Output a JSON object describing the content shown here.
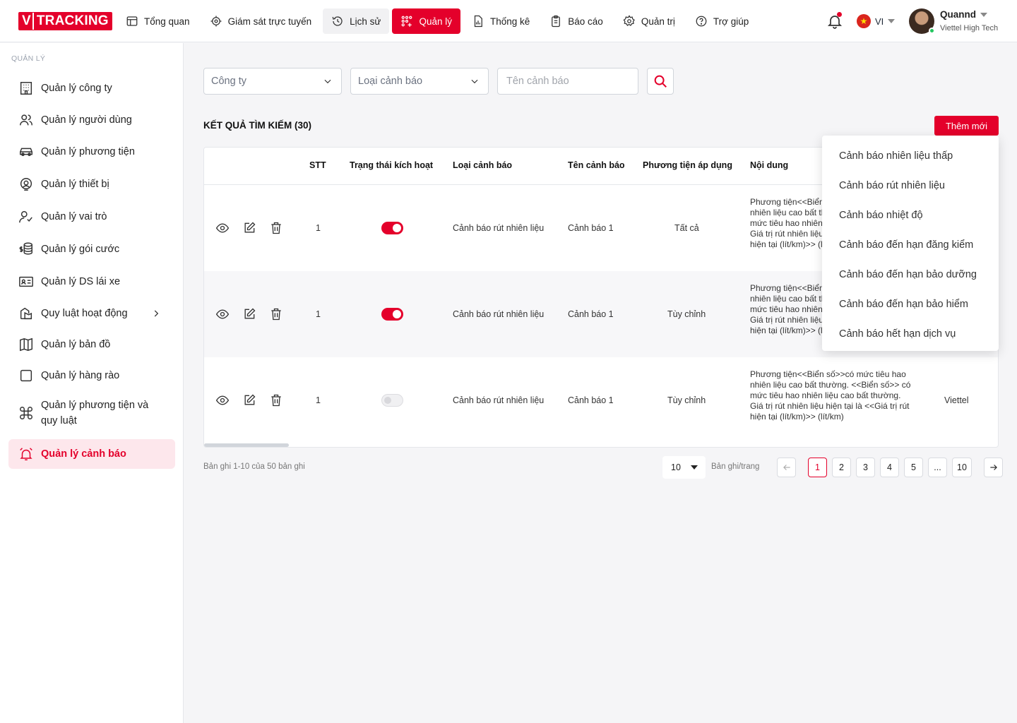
{
  "brand": {
    "logo_v": "V",
    "logo_text": "TRACKING",
    "accent": "#e4002b"
  },
  "nav": {
    "items": [
      {
        "label": "Tổng quan",
        "icon": "dashboard-icon"
      },
      {
        "label": "Giám sát trực tuyến",
        "icon": "crosshair-icon"
      },
      {
        "label": "Lịch sử",
        "icon": "history-icon"
      },
      {
        "label": "Quản lý",
        "icon": "management-icon"
      },
      {
        "label": "Thống kê",
        "icon": "chart-file-icon"
      },
      {
        "label": "Báo cáo",
        "icon": "clipboard-icon"
      },
      {
        "label": "Quản trị",
        "icon": "gear-icon"
      },
      {
        "label": "Trợ giúp",
        "icon": "help-icon"
      }
    ]
  },
  "header": {
    "language": "VI",
    "user_name": "Quannd",
    "user_org": "Viettel High Tech"
  },
  "sidebar": {
    "title": "QUẢN LÝ",
    "items": [
      {
        "label": "Quản lý công ty",
        "icon": "building-icon"
      },
      {
        "label": "Quản lý người dùng",
        "icon": "users-icon"
      },
      {
        "label": "Quản lý phương tiện",
        "icon": "car-icon"
      },
      {
        "label": "Quản lý thiết bị",
        "icon": "device-icon"
      },
      {
        "label": "Quản lý vai trò",
        "icon": "user-check-icon"
      },
      {
        "label": "Quản lý gói cước",
        "icon": "coins-icon"
      },
      {
        "label": "Quản lý DS lái xe",
        "icon": "id-card-icon"
      },
      {
        "label": "Quy luật hoạt động",
        "icon": "rules-icon"
      },
      {
        "label": "Quản lý bản đồ",
        "icon": "map-icon"
      },
      {
        "label": "Quản lý hàng rào",
        "icon": "square-icon"
      },
      {
        "label": "Quản lý phương tiện và quy luật",
        "icon": "command-icon"
      },
      {
        "label": "Quản lý cảnh báo",
        "icon": "alarm-icon"
      }
    ]
  },
  "filters": {
    "company_placeholder": "Công ty",
    "alert_type_placeholder": "Loại cảnh báo",
    "alert_name_placeholder": "Tên cảnh báo"
  },
  "results": {
    "title": "KẾT QUẢ TÌM KIẾM (30)",
    "add_label": "Thêm mới"
  },
  "table": {
    "columns": [
      "STT",
      "Trạng thái kích hoạt",
      "Loại cảnh báo",
      "Tên cảnh báo",
      "Phương tiện áp dụng",
      "Nội dung"
    ],
    "rows": [
      {
        "stt": "1",
        "active": true,
        "type": "Cảnh báo rút nhiên liệu",
        "name": "Cảnh báo 1",
        "vehicles": "Tất cả",
        "content": "Phương tiện<<Biển số>>có mức tiêu hao nhiên liệu cao bất thường. <<Biển số>> có mức tiêu hao nhiên liệu cao bất thường. Giá trị rút nhiên liệu hiện tại là <<Giá trị rút hiện tại (lít/km)>> (lít/km)",
        "company": ""
      },
      {
        "stt": "1",
        "active": true,
        "type": "Cảnh báo rút nhiên liệu",
        "name": "Cảnh báo 1",
        "vehicles": "Tùy chỉnh",
        "content": "Phương tiện<<Biển số>>có mức tiêu hao nhiên liệu cao bất thường. <<Biển số>> có mức tiêu hao nhiên liệu cao bất thường. Giá trị rút nhiên liệu hiện tại là <<Giá trị rút hiện tại (lít/km)>> (lít/km)",
        "company": ""
      },
      {
        "stt": "1",
        "active": false,
        "type": "Cảnh báo rút nhiên liệu",
        "name": "Cảnh báo 1",
        "vehicles": "Tùy chỉnh",
        "content": "Phương tiện<<Biển số>>có mức tiêu hao nhiên liệu cao bất thường. <<Biển số>> có mức tiêu hao nhiên liệu cao bất thường. Giá trị rút nhiên liệu hiện tại là <<Giá trị rút hiện tại (lít/km)>> (lít/km)",
        "company": "Viettel"
      }
    ]
  },
  "dropdown": {
    "options": [
      "Cảnh báo nhiên liệu thấp",
      "Cảnh báo rút nhiên liệu",
      "Cảnh báo nhiệt độ",
      "Cảnh báo đến hạn đăng kiểm",
      "Cảnh báo đến hạn bảo dưỡng",
      "Cảnh báo đến hạn bảo hiểm",
      "Cảnh báo hết hạn dịch vụ"
    ]
  },
  "pagination": {
    "info": "Bản ghi 1-10 của 50 bản ghi",
    "per_page": "10",
    "per_page_label": "Bản ghi/trang",
    "pages": [
      "1",
      "2",
      "3",
      "4",
      "5",
      "...",
      "10"
    ],
    "current": "1"
  }
}
